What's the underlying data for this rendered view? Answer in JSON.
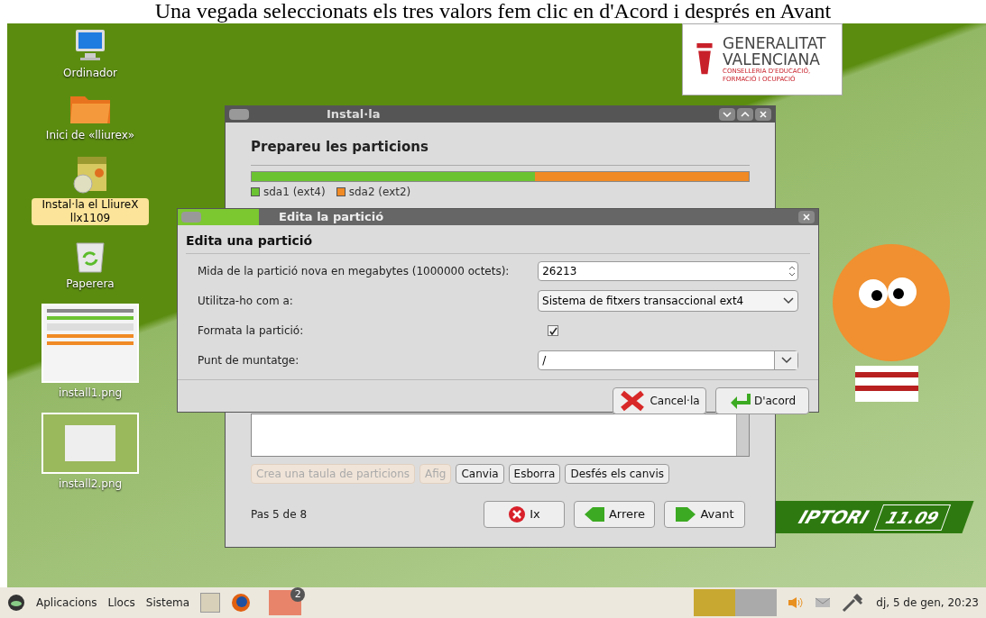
{
  "caption": "Una vegada seleccionats els tres valors fem clic en d'Acord i després en Avant",
  "desktop_icons": [
    {
      "kind": "computer",
      "label": "Ordinador",
      "selected": false
    },
    {
      "kind": "folder",
      "label": "Inici de «lliurex»",
      "selected": false
    },
    {
      "kind": "installer",
      "label": "Instal·la el LliureX llx1109",
      "selected": true
    },
    {
      "kind": "trash",
      "label": "Paperera",
      "selected": false
    },
    {
      "kind": "thumb1",
      "label": "install1.png",
      "selected": false
    },
    {
      "kind": "thumb2",
      "label": "install2.png",
      "selected": false
    }
  ],
  "logo": {
    "lines": [
      "GENERALITAT",
      "VALENCIANA"
    ],
    "sub": "CONSELLERIA D'EDUCACIÓ, FORMACIÓ I OCUPACIÓ"
  },
  "wallpaper": {
    "brand": "IPTORI",
    "version": "11.09"
  },
  "install_window": {
    "title": "Instal·la",
    "heading": "Prepareu les particions",
    "partitions": [
      {
        "name": "sda1 (ext4)",
        "color": "#6cc332",
        "level": 0.57
      },
      {
        "name": "sda2 (ext2)",
        "color": "#f08a24",
        "level": 0.43
      }
    ],
    "buttons": [
      {
        "label": "Crea una taula de particions",
        "disabled": true
      },
      {
        "label": "Afig",
        "disabled": true
      },
      {
        "label": "Canvia",
        "disabled": false
      },
      {
        "label": "Esborra",
        "disabled": false
      },
      {
        "label": "Desfés els canvis",
        "disabled": false
      }
    ],
    "step": "Pas 5 de 8",
    "nav": [
      {
        "kind": "quit",
        "label": "Ix"
      },
      {
        "kind": "back",
        "label": "Arrere"
      },
      {
        "kind": "forward",
        "label": "Avant"
      }
    ]
  },
  "dialog": {
    "title": "Edita la partició",
    "heading": "Edita una partició",
    "fields": [
      {
        "kind": "spin",
        "label": "Mida de la partició nova en megabytes (1000000 octets):",
        "value": "26213"
      },
      {
        "kind": "combo",
        "label": "Utilitza-ho com a:",
        "value": "Sistema de fitxers transaccional ext4"
      },
      {
        "kind": "checkbox",
        "label": "Formata la partició:",
        "checked": true
      },
      {
        "kind": "entry",
        "label": "Punt de muntatge:",
        "value": "/"
      }
    ],
    "buttons": [
      {
        "kind": "cancel",
        "label": "Cancel·la"
      },
      {
        "kind": "ok",
        "label": "D'acord"
      }
    ]
  },
  "taskbar": {
    "menus": [
      "Aplicacions",
      "Llocs",
      "Sistema"
    ],
    "badge": "2",
    "clock": "dj, 5 de gen, 20:23"
  }
}
